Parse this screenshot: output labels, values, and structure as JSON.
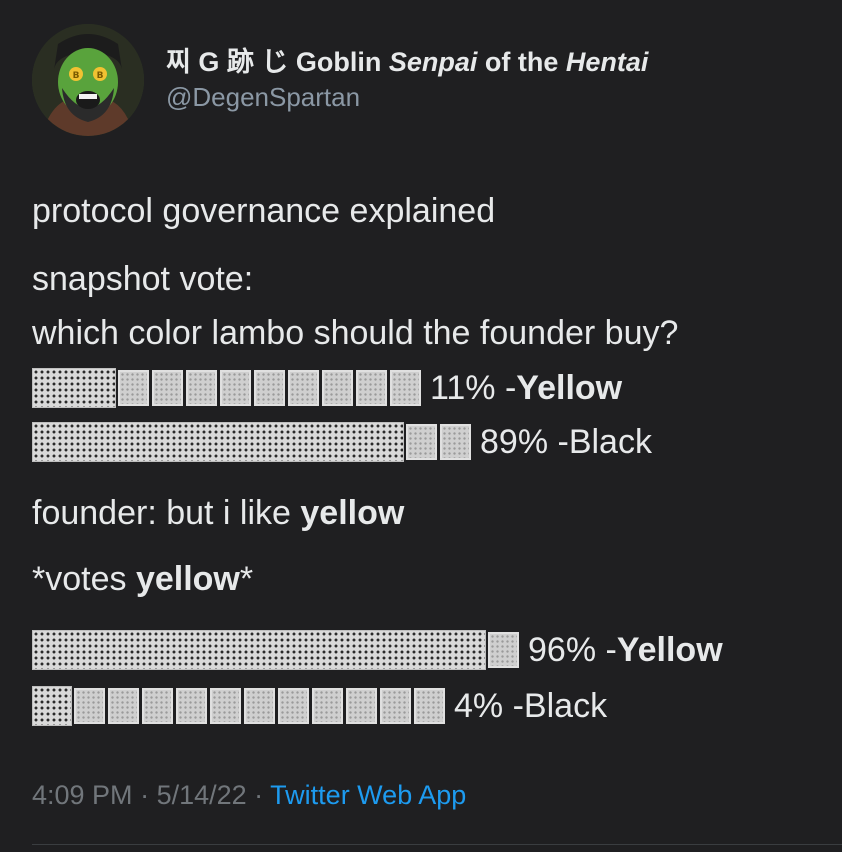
{
  "author": {
    "display_name_prefix": "찌 G 跡 じ Goblin ",
    "display_name_italic_1": "Senpai",
    "display_name_mid": " of the ",
    "display_name_italic_2": "Hentai",
    "handle": "@DegenSpartan",
    "avatar_icon": "goblin-spartan-avatar"
  },
  "body": {
    "line1": "protocol governance explained",
    "line2": "snapshot vote:",
    "line3": "which color lambo should the founder buy?",
    "poll1": [
      {
        "percent_text": "11% - ",
        "option": "Yellow",
        "option_bold": true,
        "fraction": 0.11
      },
      {
        "percent_text": "89% - ",
        "option": "Black",
        "option_bold": false,
        "fraction": 0.89
      }
    ],
    "line4_prefix": "founder: but i like ",
    "line4_bold": "yellow",
    "line5_prefix": "*votes ",
    "line5_bold": "yellow",
    "line5_suffix": "*",
    "poll2": [
      {
        "percent_text": "96% - ",
        "option": "Yellow",
        "option_bold": true,
        "fraction": 0.96
      },
      {
        "percent_text": "4% - ",
        "option": "Black",
        "option_bold": false,
        "fraction": 0.04
      }
    ]
  },
  "meta": {
    "time": "4:09 PM",
    "sep1": " · ",
    "date": "5/14/22",
    "sep2": " · ",
    "source": "Twitter Web App"
  },
  "colors": {
    "background": "#1f1f21",
    "text": "#e7e9ea",
    "muted": "#71767b",
    "link": "#1d9bf0"
  }
}
